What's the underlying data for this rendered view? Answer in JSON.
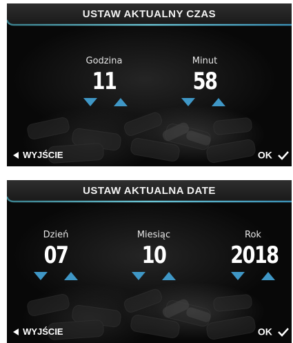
{
  "colors": {
    "accent": "#4a9fc2",
    "arrow_fill": "#3f97c6",
    "title_line": "#5db6c8"
  },
  "time_screen": {
    "title": "USTAW AKTUALNY CZAS",
    "fields": [
      {
        "label": "Godzina",
        "value": "11"
      },
      {
        "label": "Minut",
        "value": "58"
      }
    ],
    "back_label": "WYJŚCIE",
    "ok_label": "OK"
  },
  "date_screen": {
    "title": "USTAW AKTUALNA DATE",
    "fields": [
      {
        "label": "Dzień",
        "value": "07"
      },
      {
        "label": "Miesiąc",
        "value": "10"
      },
      {
        "label": "Rok",
        "value": "2018"
      }
    ],
    "back_label": "WYJŚCIE",
    "ok_label": "OK"
  },
  "icons": {
    "down": "triangle-down-icon",
    "up": "triangle-up-icon",
    "back": "triangle-left-icon",
    "ok": "checkmark-icon"
  }
}
